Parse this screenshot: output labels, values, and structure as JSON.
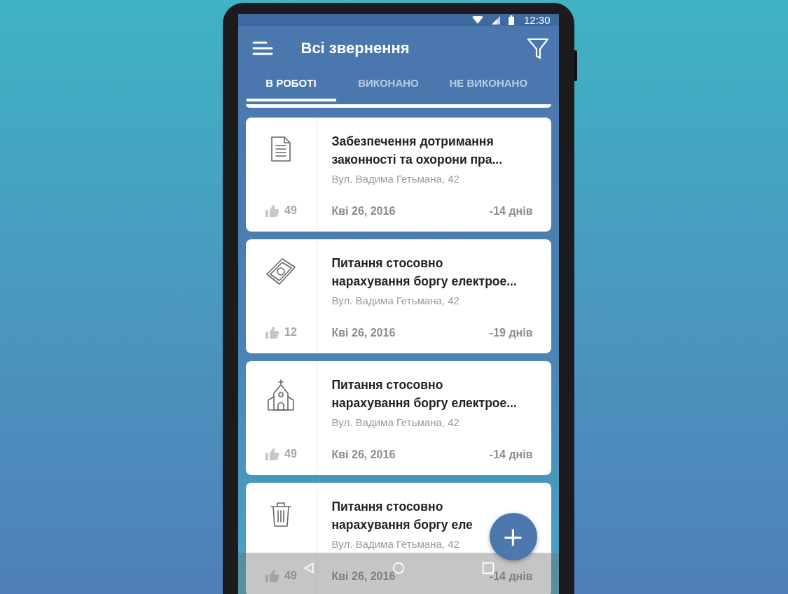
{
  "status_bar": {
    "time": "12:30"
  },
  "app_bar": {
    "title": "Всі звернення"
  },
  "tabs": [
    {
      "label": "В РОБОТІ",
      "selected": true
    },
    {
      "label": "ВИКОНАНО",
      "selected": false
    },
    {
      "label": "НЕ ВИКОНАНО",
      "selected": false
    }
  ],
  "cards": [
    {
      "kind": "document",
      "title": "Забезпечення дотримання законності та охорони пра...",
      "address": "Вул. Вадима Гетьмана, 42",
      "likes": "49",
      "date": "Кві 26, 2016",
      "days": "-14 днів"
    },
    {
      "kind": "money",
      "title": "Питання стосовно нарахування боргу електрое...",
      "address": "Вул. Вадима Гетьмана, 42",
      "likes": "12",
      "date": "Кві 26, 2016",
      "days": "-19 днів"
    },
    {
      "kind": "church",
      "title": "Питання стосовно нарахування боргу електрое...",
      "address": "Вул. Вадима Гетьмана, 42",
      "likes": "49",
      "date": "Кві 26, 2016",
      "days": "-14 днів"
    },
    {
      "kind": "trash",
      "title": "Питання стосовно нарахування боргу еле",
      "address": "Вул. Вадима Гетьмана, 42",
      "likes": "49",
      "date": "Кві 26, 2016",
      "days": "-14 днів"
    }
  ],
  "fab": {
    "label": "+"
  }
}
